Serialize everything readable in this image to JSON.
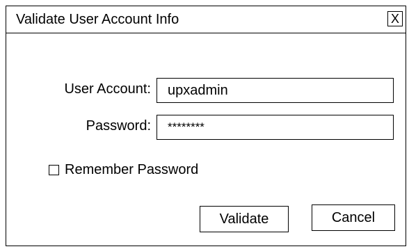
{
  "dialog": {
    "title": "Validate User Account Info",
    "close_label": "X"
  },
  "form": {
    "account_label": "User Account:",
    "account_value": "upxadmin",
    "password_label": "Password:",
    "password_value": "********",
    "remember_label": "Remember Password",
    "remember_checked": false
  },
  "buttons": {
    "validate_label": "Validate",
    "cancel_label": "Cancel"
  }
}
